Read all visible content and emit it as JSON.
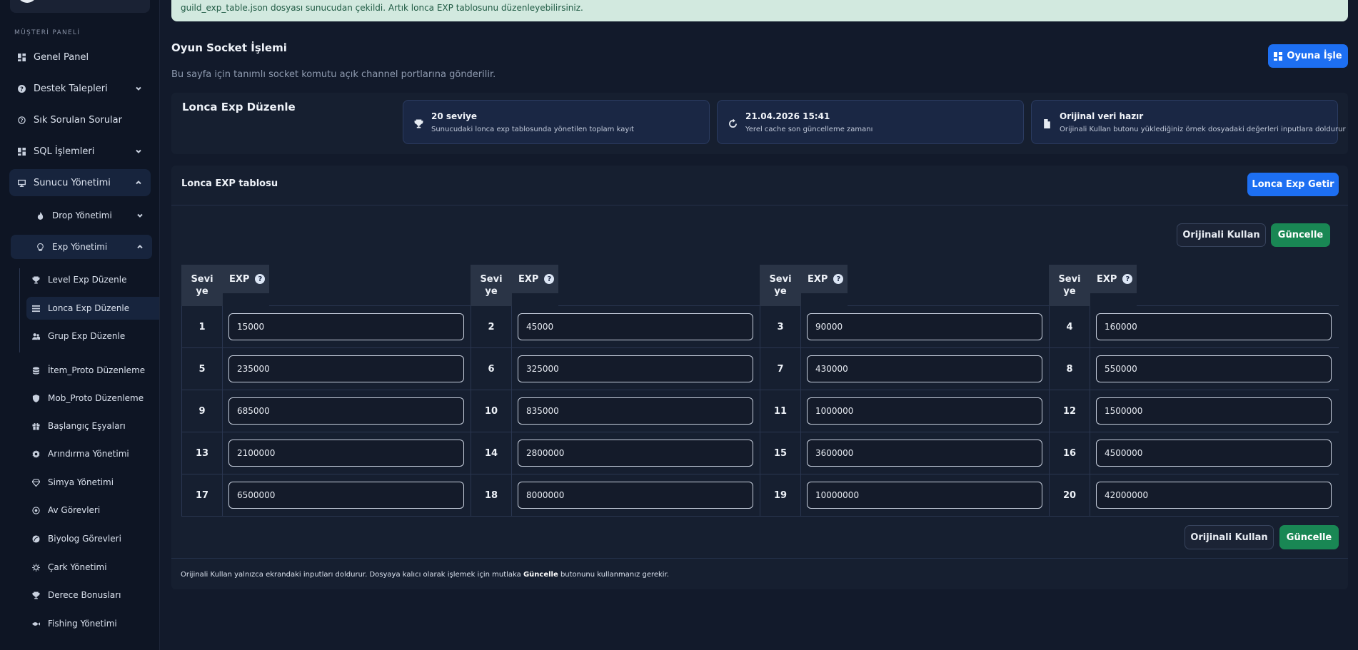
{
  "alert": {
    "text": "guild_exp_table.json dosyası sunucudan çekildi. Artık lonca EXP tablosunu düzenleyebilirsiniz."
  },
  "sidebar": {
    "section_label": "MÜŞTERİ PANELİ",
    "items": [
      {
        "label": "Genel Panel",
        "icon": "dashboard-icon"
      },
      {
        "label": "Destek Talepleri",
        "icon": "help-circle-icon"
      },
      {
        "label": "Sık Sorulan Sorular",
        "icon": "question-icon"
      },
      {
        "label": "SQL İşlemleri",
        "icon": "dashboard-icon"
      },
      {
        "label": "Sunucu Yönetimi",
        "icon": "monitor-icon"
      },
      {
        "label": "Drop Yönetimi",
        "icon": "flame-icon"
      },
      {
        "label": "Exp Yönetimi",
        "icon": "lightbulb-icon"
      },
      {
        "label": "Level Exp Düzenle",
        "icon": "trophy-icon"
      },
      {
        "label": "Lonca Exp Düzenle",
        "icon": "list-icon"
      },
      {
        "label": "Grup Exp Düzenle",
        "icon": "users-icon"
      },
      {
        "label": "İtem_Proto Düzenleme",
        "icon": "database-icon"
      },
      {
        "label": "Mob_Proto Düzenleme",
        "icon": "shield-icon"
      },
      {
        "label": "Başlangıç Eşyaları",
        "icon": "gift-icon"
      },
      {
        "label": "Arındırma Yönetimi",
        "icon": "gear-icon"
      },
      {
        "label": "Simya Yönetimi",
        "icon": "gem-icon"
      },
      {
        "label": "Av Görevleri",
        "icon": "target-icon"
      },
      {
        "label": "Biyolog Görevleri",
        "icon": "leaf-icon"
      },
      {
        "label": "Çark Yönetimi",
        "icon": "wheel-icon"
      },
      {
        "label": "Derece Bonusları",
        "icon": "trophy-icon"
      },
      {
        "label": "Fishing Yönetimi",
        "icon": "fish-icon"
      }
    ]
  },
  "header": {
    "title": "Oyun Socket İşlemi",
    "subtitle": "Bu sayfa için tanımlı socket komutu açık channel portlarına gönderilir.",
    "push_button": "Oyuna İşle"
  },
  "summary": {
    "title": "Lonca Exp Düzenle",
    "stats": [
      {
        "title": "20 seviye",
        "desc": "Sunucudaki lonca exp tablosunda yönetilen toplam kayıt",
        "icon": "trophy-icon"
      },
      {
        "title": "21.04.2026 15:41",
        "desc": "Yerel cache son güncelleme zamanı",
        "icon": "refresh-icon"
      },
      {
        "title": "Orijinal veri hazır",
        "desc": "Orijinali Kullan butonu yüklediğiniz örnek dosyadaki değerleri inputlara doldurur",
        "icon": "file-icon"
      }
    ]
  },
  "table_panel": {
    "title": "Lonca EXP tablosu",
    "fetch_button": "Lonca Exp Getir",
    "original_button": "Orijinali Kullan",
    "update_button": "Güncelle",
    "col_level": "Seviye",
    "col_exp": "EXP",
    "help_glyph": "?",
    "rows": [
      {
        "level": "1",
        "exp": "15000"
      },
      {
        "level": "2",
        "exp": "45000"
      },
      {
        "level": "3",
        "exp": "90000"
      },
      {
        "level": "4",
        "exp": "160000"
      },
      {
        "level": "5",
        "exp": "235000"
      },
      {
        "level": "6",
        "exp": "325000"
      },
      {
        "level": "7",
        "exp": "430000"
      },
      {
        "level": "8",
        "exp": "550000"
      },
      {
        "level": "9",
        "exp": "685000"
      },
      {
        "level": "10",
        "exp": "835000"
      },
      {
        "level": "11",
        "exp": "1000000"
      },
      {
        "level": "12",
        "exp": "1500000"
      },
      {
        "level": "13",
        "exp": "2100000"
      },
      {
        "level": "14",
        "exp": "2800000"
      },
      {
        "level": "15",
        "exp": "3600000"
      },
      {
        "level": "16",
        "exp": "4500000"
      },
      {
        "level": "17",
        "exp": "6500000"
      },
      {
        "level": "18",
        "exp": "8000000"
      },
      {
        "level": "19",
        "exp": "10000000"
      },
      {
        "level": "20",
        "exp": "42000000"
      }
    ],
    "footnote_prefix": "Orijinali Kullan yalnızca ekrandaki inputları doldurur. Dosyaya kalıcı olarak işlemek için mutlaka",
    "footnote_bold": "Güncelle",
    "footnote_suffix": "butonunu kullanmanız gerekir."
  }
}
